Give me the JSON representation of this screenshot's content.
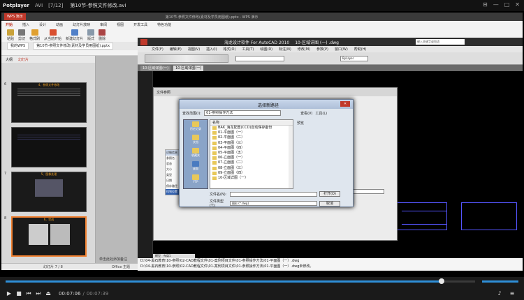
{
  "player": {
    "name": "Potplayer",
    "format": "AVI",
    "playlist_pos": "[7/12]",
    "file_title": "第10节-参照文件修改.avi",
    "time_current": "00:07:06",
    "time_total": "00:07:39",
    "progress": 0.928,
    "volume": 1.0
  },
  "wps": {
    "app_tag": "WPS 演示",
    "doc_title": "第10节-参照文件修改(素材及学员用图纸).pptx - WPS 演示",
    "menu_tabs": [
      "开始",
      "插入",
      "设计",
      "动画",
      "幻灯片放映",
      "审阅",
      "视图",
      "开发工具",
      "特色功能"
    ],
    "tools": [
      "粘贴",
      "剪切",
      "格式刷",
      "从当前开始",
      "新建幻灯片",
      "版式",
      "删除"
    ],
    "doc_tabs": [
      "我的WPS",
      "第10节-参照文件修改(素材及学员用图纸).pptx"
    ],
    "panel_tabs": [
      "大纲",
      "幻灯片"
    ],
    "slides": [
      {
        "num": "6",
        "title": "4、参照文件修改"
      },
      {
        "num": "7",
        "title": "5、图像处理"
      },
      {
        "num": "8",
        "title": "6、完成"
      }
    ],
    "status_left": "幻灯片 7 / 8",
    "status_mid": "Office 主题",
    "status_right": "单击此处添加备注"
  },
  "cad": {
    "title": "海龙设计软件 For AutoCAD 2010",
    "drawing": "10-区域详图 (一) .dwg",
    "search_placeholder": "键入关键字或短语",
    "menu": [
      "文件(F)",
      "编辑(E)",
      "视图(V)",
      "插入(I)",
      "格式(O)",
      "工具(T)",
      "绘图(D)",
      "标注(N)",
      "修改(M)",
      "参数(P)",
      "窗口(W)",
      "帮助(H)"
    ],
    "tabs": [
      "10-区域详图(一)",
      "10-区域详图(一)"
    ],
    "layer": "ByLayer",
    "model_tabs": [
      "模型",
      "布局1"
    ],
    "command_lines": [
      "D:\\04-黑石教育\\10-参照\\02-CAD教程文件\\01-案例项目文件\\01-参照操作方法\\01-平面图（一）.dwg",
      "D:\\04-黑石教育\\10-参照\\02-CAD教程文件\\01-案例项目文件\\01-参照操作方法\\01-平面图（一）.dwg未修改。"
    ],
    "prop_labels": [
      "参照名",
      "状态",
      "大小",
      "类型",
      "日期",
      "保存路径",
      "找到位置"
    ],
    "prop_header": "文件参照",
    "details_label": "详细信息"
  },
  "dialog": {
    "title": "选择新路径",
    "look_in_label": "查找范围(I):",
    "look_in_value": "01-参照操作方法",
    "view_label": "查看(V)",
    "tools_label": "工具(L)",
    "preview_label": "预览",
    "column_name": "名称",
    "places": [
      "历史记录",
      "文档",
      "收藏夹",
      "桌面",
      "FTP"
    ],
    "files": [
      "BAK_海龙配置(CCD)自动保存备份",
      "01-平面图（一）",
      "02-平面图（二）",
      "03-平面图（三）",
      "04-平面图（四）",
      "05-平面图（五）",
      "06-立面图（一）",
      "07-立面图（二）",
      "08-立面图（三）",
      "09-立面图（四）",
      "10-区域详图（一）"
    ],
    "file_name_label": "文件名(N):",
    "file_type_label": "文件类型(T):",
    "file_type_value": "图形 (*.dwg)",
    "open_button": "打开(O)",
    "cancel_button": "取消"
  }
}
